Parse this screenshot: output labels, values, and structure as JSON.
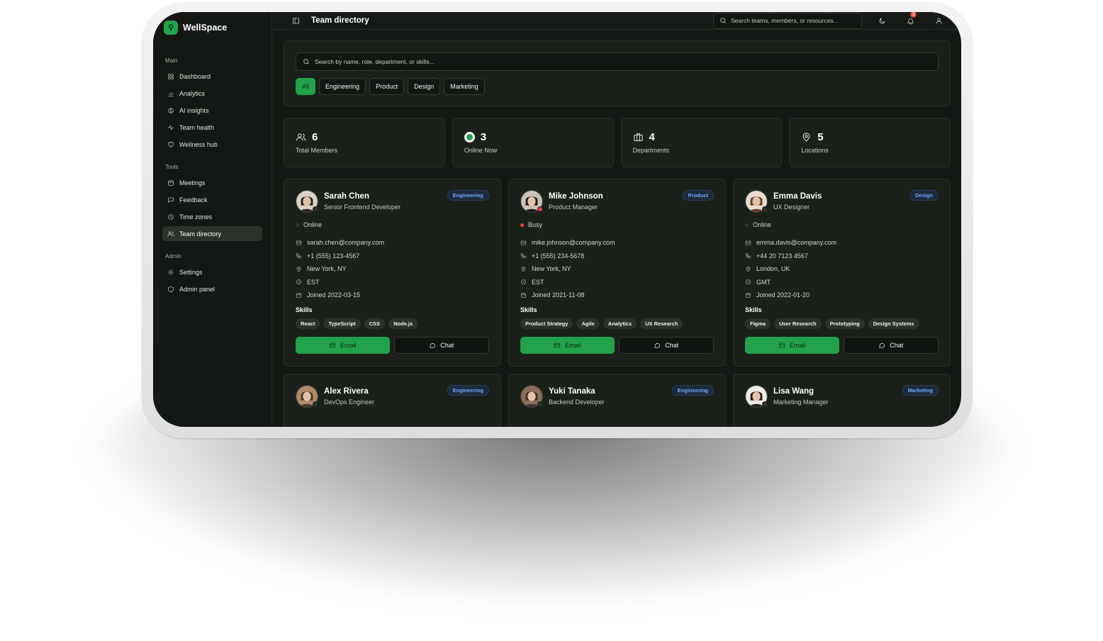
{
  "app": {
    "name": "WellSpace"
  },
  "sidebar": {
    "sections": [
      {
        "title": "Main",
        "items": [
          {
            "label": "Dashboard",
            "icon": "grid-icon"
          },
          {
            "label": "Analytics",
            "icon": "bar-chart-icon"
          },
          {
            "label": "AI insights",
            "icon": "brain-icon"
          },
          {
            "label": "Team health",
            "icon": "pulse-icon"
          },
          {
            "label": "Wellness hub",
            "icon": "heart-icon"
          }
        ]
      },
      {
        "title": "Tools",
        "items": [
          {
            "label": "Meetings",
            "icon": "calendar-icon"
          },
          {
            "label": "Feedback",
            "icon": "message-icon"
          },
          {
            "label": "Time zones",
            "icon": "clock-icon"
          },
          {
            "label": "Team directory",
            "icon": "users-icon",
            "active": true
          }
        ]
      },
      {
        "title": "Admin",
        "items": [
          {
            "label": "Settings",
            "icon": "gear-icon"
          },
          {
            "label": "Admin panel",
            "icon": "shield-icon"
          }
        ]
      }
    ]
  },
  "header": {
    "title": "Team directory",
    "search_placeholder": "Search teams, members, or resources...",
    "notification_count": "3"
  },
  "filters": {
    "search_placeholder": "Search by name, role, department, or skills...",
    "chips": [
      "All",
      "Engineering",
      "Product",
      "Design",
      "Marketing"
    ],
    "active_chip": "All"
  },
  "stats": [
    {
      "value": "6",
      "label": "Total Members",
      "icon": "users-icon"
    },
    {
      "value": "3",
      "label": "Online Now",
      "icon": "online-indicator-icon"
    },
    {
      "value": "4",
      "label": "Departments",
      "icon": "briefcase-icon"
    },
    {
      "value": "5",
      "label": "Locations",
      "icon": "map-pin-icon"
    }
  ],
  "colors": {
    "accent": "#22a24a",
    "online": "#22a24a",
    "busy": "#e0463a",
    "badge_blue": "#6fa8ff"
  },
  "members": [
    {
      "name": "Sarah Chen",
      "role": "Senior Frontend Developer",
      "department": "Engineering",
      "status": "Online",
      "email": "sarah.chen@company.com",
      "phone": "+1 (555) 123-4567",
      "location": "New York, NY",
      "timezone": "EST",
      "joined": "Joined 2022-03-15",
      "skills": [
        "React",
        "TypeScript",
        "CSS",
        "Node.js"
      ]
    },
    {
      "name": "Mike Johnson",
      "role": "Product Manager",
      "department": "Product",
      "status": "Busy",
      "email": "mike.johnson@company.com",
      "phone": "+1 (555) 234-5678",
      "location": "New York, NY",
      "timezone": "EST",
      "joined": "Joined 2021-11-08",
      "skills": [
        "Product Strategy",
        "Agile",
        "Analytics",
        "UX Research"
      ]
    },
    {
      "name": "Emma Davis",
      "role": "UX Designer",
      "department": "Design",
      "status": "Online",
      "email": "emma.davis@company.com",
      "phone": "+44 20 7123 4567",
      "location": "London, UK",
      "timezone": "GMT",
      "joined": "Joined 2022-01-20",
      "skills": [
        "Figma",
        "User Research",
        "Prototyping",
        "Design Systems"
      ]
    },
    {
      "name": "Alex Rivera",
      "role": "DevOps Engineer",
      "department": "Engineering"
    },
    {
      "name": "Yuki Tanaka",
      "role": "Backend Developer",
      "department": "Engineering"
    },
    {
      "name": "Lisa Wang",
      "role": "Marketing Manager",
      "department": "Marketing"
    }
  ],
  "labels": {
    "skills": "Skills",
    "email_button": "Email",
    "chat_button": "Chat"
  }
}
